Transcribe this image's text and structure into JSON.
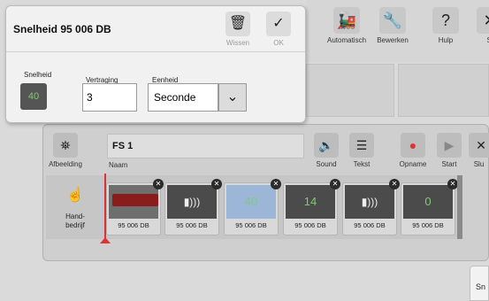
{
  "dialog": {
    "title": "Snelheid 95 006 DB",
    "delete_label": "Wissen",
    "ok_label": "OK",
    "speed_label": "Snelheid",
    "speed_value": "40",
    "delay_label": "Vertraging",
    "delay_value": "3",
    "unit_label": "Eenheid",
    "unit_value": "Seconde"
  },
  "toolbar": {
    "automatic": "Automatisch",
    "edit": "Bewerken",
    "help": "Hulp",
    "close_partial": "Sl"
  },
  "train": {
    "image_label": "Afbeelding",
    "name_value": "FS 1",
    "name_label": "Naam",
    "sound_label": "Sound",
    "text_label": "Tekst",
    "record_label": "Opname",
    "start_label": "Start",
    "close_partial": "Slu",
    "hand_label": "Hand-\nbedrijf",
    "tiles": [
      {
        "kind": "loco",
        "value": "",
        "label": "95 006 DB"
      },
      {
        "kind": "horn",
        "value": "",
        "label": "95 006 DB"
      },
      {
        "kind": "speed",
        "value": "40",
        "label": "95 006 DB",
        "selected": true
      },
      {
        "kind": "speed",
        "value": "14",
        "label": "95 006 DB"
      },
      {
        "kind": "horn",
        "value": "",
        "label": "95 006 DB"
      },
      {
        "kind": "speed",
        "value": "0",
        "label": "95 006 DB"
      }
    ]
  },
  "corner": {
    "label": "Sn"
  },
  "colors": {
    "speed_green": "#7ecb6e",
    "marker_red": "#dd3333",
    "selected_tile": "#9cb6d8"
  }
}
